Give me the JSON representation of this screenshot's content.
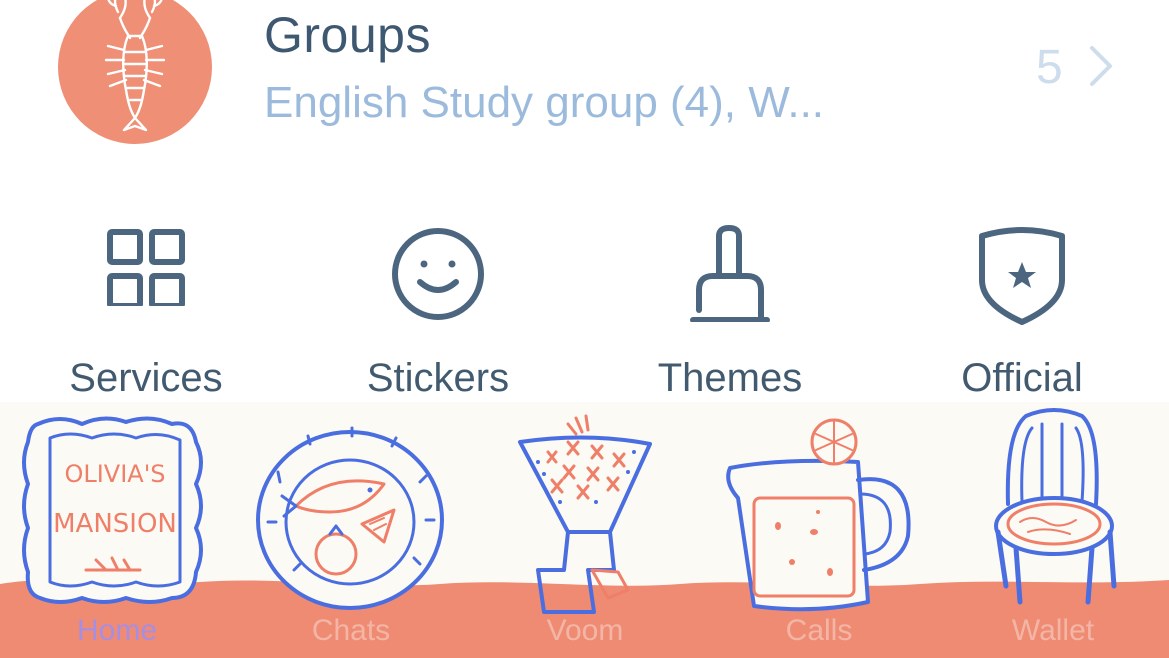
{
  "groups": {
    "title": "Groups",
    "subtitle": "English Study group (4), W...",
    "count": "5",
    "avatar_icon": "lobster-icon",
    "avatar_color": "#ef8f75"
  },
  "shortcuts": [
    {
      "label": "Services",
      "icon": "grid-icon"
    },
    {
      "label": "Stickers",
      "icon": "smiley-icon"
    },
    {
      "label": "Themes",
      "icon": "paintbrush-icon"
    },
    {
      "label": "Official",
      "icon": "shield-star-icon"
    }
  ],
  "tabbar": {
    "active": "Home",
    "items": [
      {
        "label": "Home",
        "icon": "olivias-mansion-sign-icon",
        "sign_lines": [
          "OLIVIA'S",
          "MANSION"
        ]
      },
      {
        "label": "Chats",
        "icon": "plate-fish-icon"
      },
      {
        "label": "Voom",
        "icon": "bouquet-icon"
      },
      {
        "label": "Calls",
        "icon": "pitcher-icon"
      },
      {
        "label": "Wallet",
        "icon": "chair-icon"
      }
    ]
  },
  "colors": {
    "title_text": "#3f5871",
    "subtitle_text": "#9cbbdc",
    "icon_stroke": "#4d6680",
    "illustration_blue": "#4a6ee0",
    "illustration_coral": "#ef7f68",
    "tab_label": "#f3b6a6",
    "tab_label_active": "#a88ee0"
  }
}
